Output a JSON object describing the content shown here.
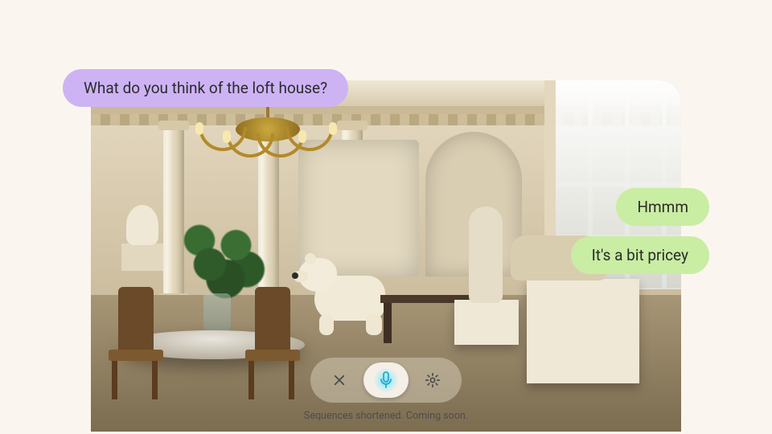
{
  "chat": {
    "user_question": "What do you think of the loft house?",
    "agent_reply_1": "Hmmm",
    "agent_reply_2": "It's a bit pricey"
  },
  "caption": "Sequences shortened. Coming soon.",
  "icons": {
    "close": "close-icon",
    "mic": "microphone-icon",
    "settings": "gear-icon"
  },
  "colors": {
    "user_bubble": "#cdb3f4",
    "agent_bubble": "#c9eda3",
    "page_bg": "#faf6ef",
    "mic_glow": "#7fe7ff"
  }
}
